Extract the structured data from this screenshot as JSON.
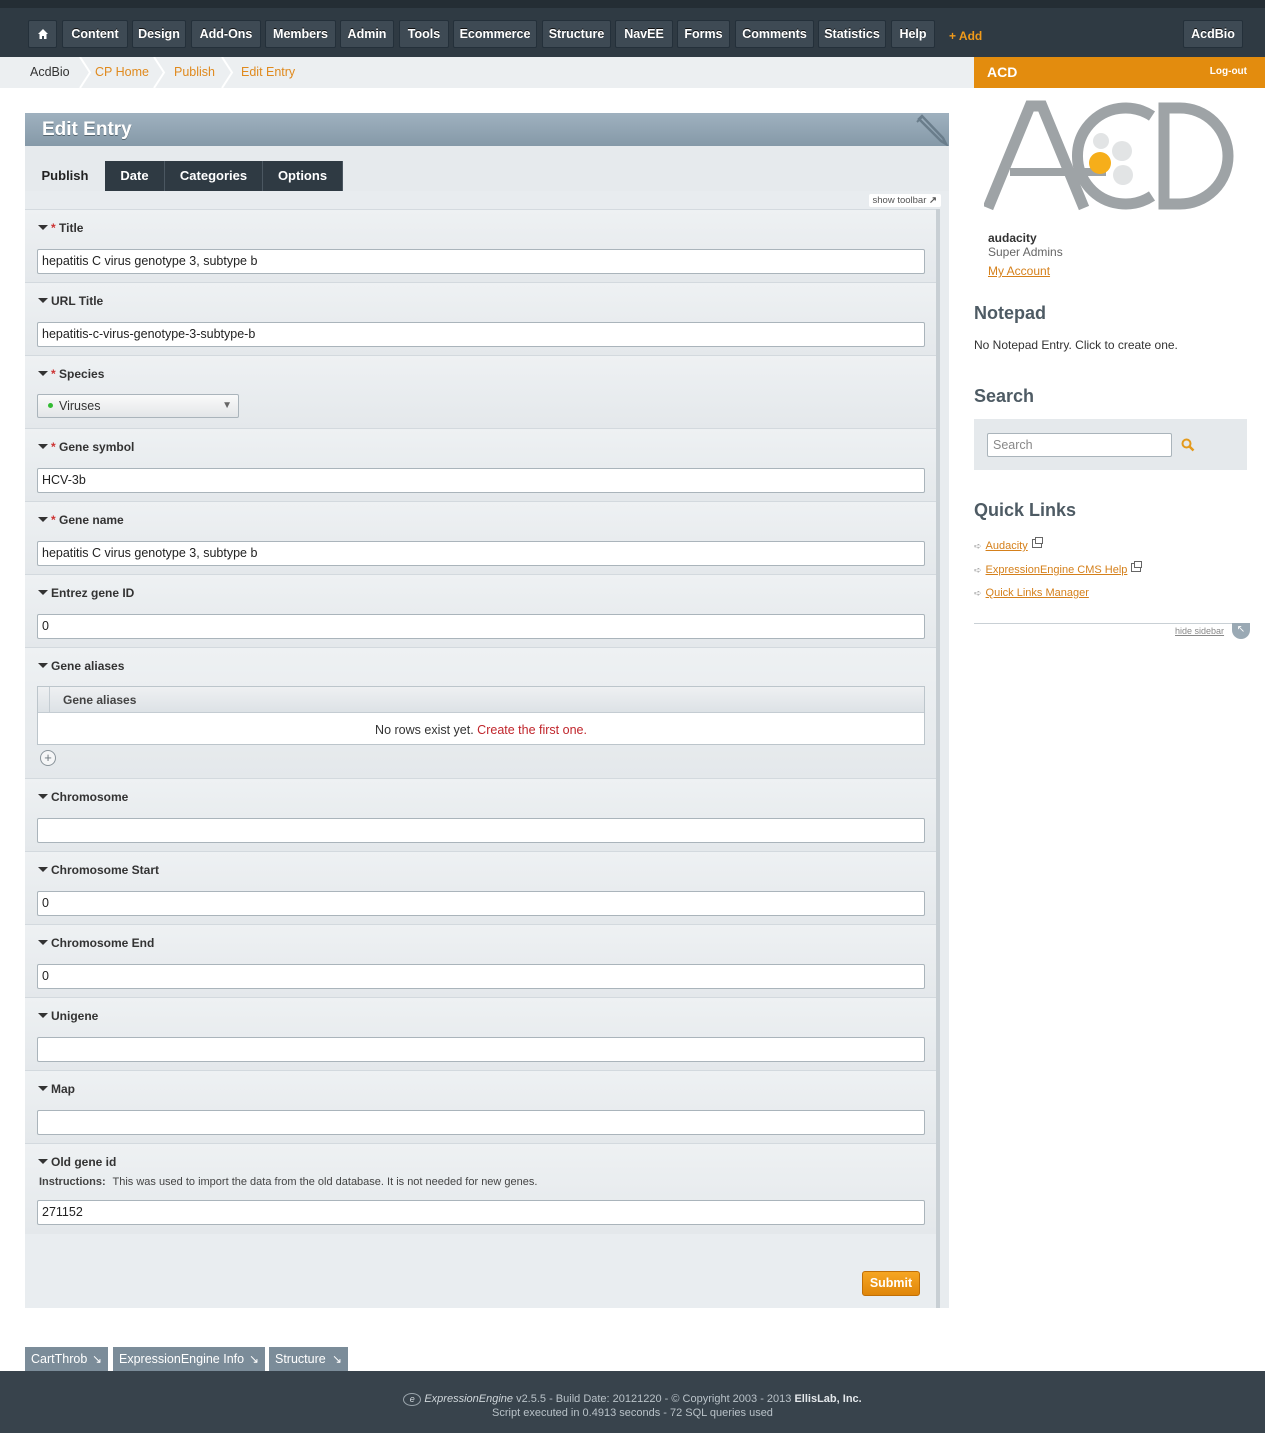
{
  "nav": {
    "items": [
      "Content",
      "Design",
      "Add-Ons",
      "Members",
      "Admin",
      "Tools",
      "Ecommerce",
      "Structure",
      "NavEE",
      "Forms",
      "Comments",
      "Statistics",
      "Help"
    ],
    "add_label": "+ Add",
    "site_label": "AcdBio"
  },
  "breadcrumb": [
    "AcdBio",
    "CP Home",
    "Publish",
    "Edit Entry"
  ],
  "sidebar_header": {
    "title": "ACD",
    "logout": "Log-out"
  },
  "page": {
    "title": "Edit Entry"
  },
  "tabs": [
    "Publish",
    "Date",
    "Categories",
    "Options"
  ],
  "show_toolbar": "show toolbar",
  "fields": {
    "title": {
      "label": "Title",
      "value": "hepatitis C virus genotype 3, subtype b"
    },
    "url_title": {
      "label": "URL Title",
      "value": "hepatitis-c-virus-genotype-3-subtype-b"
    },
    "species": {
      "label": "Species",
      "value": "Viruses"
    },
    "gene_symbol": {
      "label": "Gene symbol",
      "value": "HCV-3b"
    },
    "gene_name": {
      "label": "Gene name",
      "value": "hepatitis C virus genotype 3, subtype b"
    },
    "entrez": {
      "label": "Entrez gene ID",
      "value": "0"
    },
    "gene_aliases": {
      "label": "Gene aliases",
      "column": "Gene aliases",
      "empty_text": "No rows exist yet.",
      "create_link": "Create the first one."
    },
    "chromosome": {
      "label": "Chromosome",
      "value": ""
    },
    "chrom_start": {
      "label": "Chromosome Start",
      "value": "0"
    },
    "chrom_end": {
      "label": "Chromosome End",
      "value": "0"
    },
    "unigene": {
      "label": "Unigene",
      "value": ""
    },
    "map": {
      "label": "Map",
      "value": ""
    },
    "old_gene_id": {
      "label": "Old gene id",
      "instructions_label": "Instructions:",
      "instructions": "This was used to import the data from the old database. It is not needed for new genes.",
      "value": "271152"
    }
  },
  "required_marker": "*",
  "submit_label": "Submit",
  "user": {
    "name": "audacity",
    "group": "Super Admins",
    "account_link": "My Account"
  },
  "logo": {
    "text": "ACD"
  },
  "notepad": {
    "title": "Notepad",
    "text": "No Notepad Entry. Click to create one."
  },
  "search": {
    "title": "Search",
    "placeholder": "Search"
  },
  "quick_links": {
    "title": "Quick Links",
    "items": [
      "Audacity",
      "ExpressionEngine CMS Help",
      "Quick Links Manager"
    ],
    "hide_sidebar": "hide sidebar"
  },
  "footer_tabs": [
    "CartThrob",
    "ExpressionEngine Info",
    "Structure"
  ],
  "footer": {
    "product": "ExpressionEngine",
    "version_line": "v2.5.5 - Build Date: 20121220 - © Copyright 2003 - 2013",
    "company": "EllisLab, Inc.",
    "script_line": "Script executed in 0.4913 seconds - 72 SQL queries used"
  },
  "colors": {
    "accent": "#e38c0e",
    "nav_bg": "#2f3a43",
    "link": "#d5801b"
  }
}
